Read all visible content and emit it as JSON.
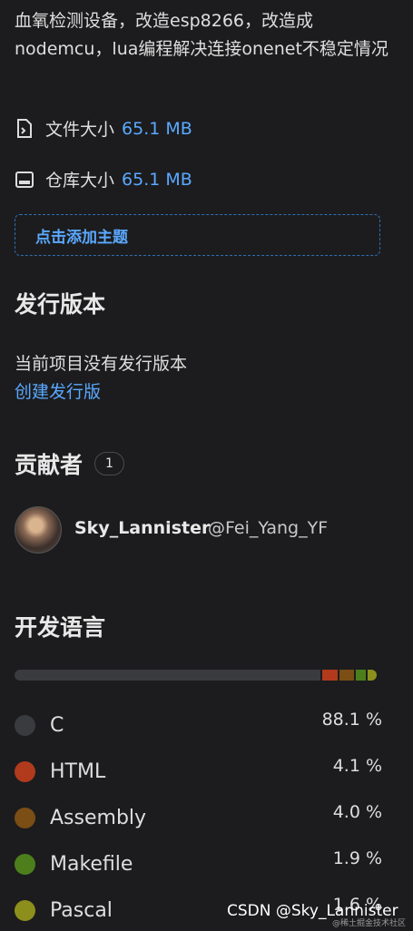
{
  "about": {
    "description": "血氧检测设备，改造esp8266，改造成nodemcu，lua编程解决连接onenet不稳定情况",
    "file_size_label": "文件大小",
    "file_size_value": "65.1 MB",
    "repo_size_label": "仓库大小",
    "repo_size_value": "65.1 MB",
    "add_topic_label": "点击添加主题"
  },
  "releases": {
    "title": "发行版本",
    "empty_text": "当前项目没有发行版本",
    "create_link": "创建发行版"
  },
  "contributors": {
    "title": "贡献者",
    "count": "1",
    "items": [
      {
        "name": "Sky_Lannister",
        "handle": "@Fei_Yang_YF"
      }
    ]
  },
  "languages": {
    "title": "开发语言",
    "items": [
      {
        "name": "C",
        "percent": "88.1 %",
        "color": "#3a3b3e"
      },
      {
        "name": "HTML",
        "percent": "4.1 %",
        "color": "#b13a1c"
      },
      {
        "name": "Assembly",
        "percent": "4.0 %",
        "color": "#7a4e14"
      },
      {
        "name": "Makefile",
        "percent": "1.9 %",
        "color": "#4c7f1c"
      },
      {
        "name": "Pascal",
        "percent": "1.6 %",
        "color": "#8d8f1c"
      }
    ]
  },
  "watermark": {
    "text": "CSDN @Sky_Lannister",
    "small": "@稀土掘金技术社区"
  }
}
